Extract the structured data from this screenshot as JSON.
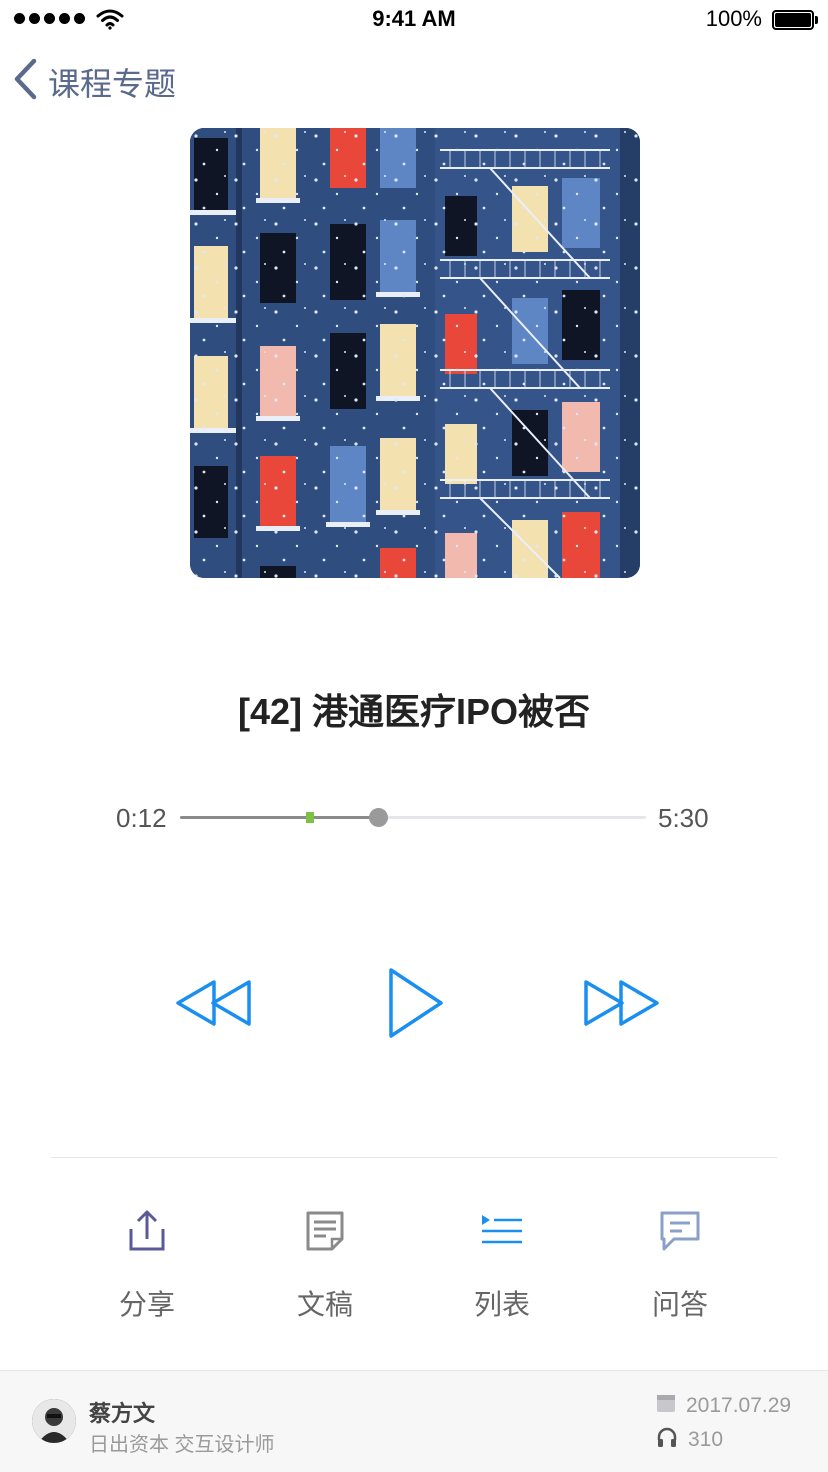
{
  "status": {
    "time": "9:41 AM",
    "battery": "100%"
  },
  "nav": {
    "back_label": "课程专题"
  },
  "track": {
    "title": "[42] 港通医疗IPO被否",
    "elapsed": "0:12",
    "total": "5:30",
    "progress": 0.425,
    "buffered": 0.28
  },
  "actions": [
    {
      "label": "分享",
      "icon": "share-icon"
    },
    {
      "label": "文稿",
      "icon": "document-icon"
    },
    {
      "label": "列表",
      "icon": "playlist-icon"
    },
    {
      "label": "问答",
      "icon": "qa-icon"
    }
  ],
  "author": {
    "name": "蔡方文",
    "description": "日出资本 交互设计师",
    "date": "2017.07.29",
    "listens": "310"
  },
  "colors": {
    "accent": "#1a8ff0",
    "nav_text": "#5a6a8c",
    "action_icon": "#5a5a9a",
    "buffer": "#7dc142"
  }
}
